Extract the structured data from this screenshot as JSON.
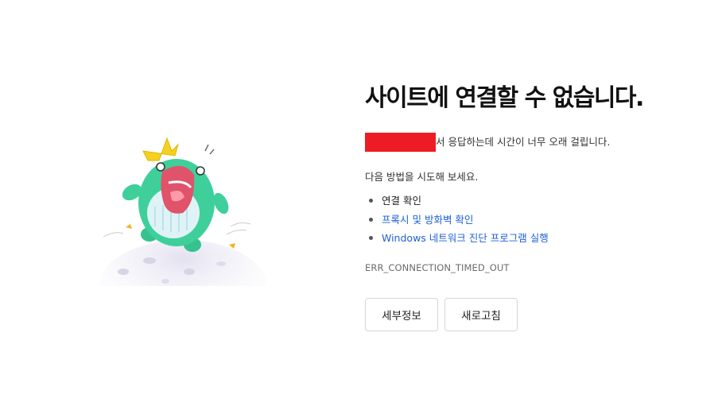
{
  "error": {
    "title": "사이트에 연결할 수 없습니다.",
    "reason_suffix": "서 응답하는데 시간이 너무 오래 걸립니다.",
    "suggestions_heading": "다음 방법을 시도해 보세요.",
    "suggestions": [
      {
        "label": "연결 확인",
        "link": false
      },
      {
        "label": "프록시 및 방화벽 확인",
        "link": true
      },
      {
        "label": "Windows 네트워크 진단 프로그램 실행",
        "link": true
      }
    ],
    "code": "ERR_CONNECTION_TIMED_OUT"
  },
  "buttons": {
    "details_label": "세부정보",
    "reload_label": "새로고침"
  },
  "colors": {
    "link": "#1f5fd6",
    "redaction": "#ed1c24",
    "mascot_body": "#3fcf9b",
    "crown": "#f5d020"
  },
  "illustration": {
    "icon": "crying-dinosaur-mascot-icon"
  }
}
